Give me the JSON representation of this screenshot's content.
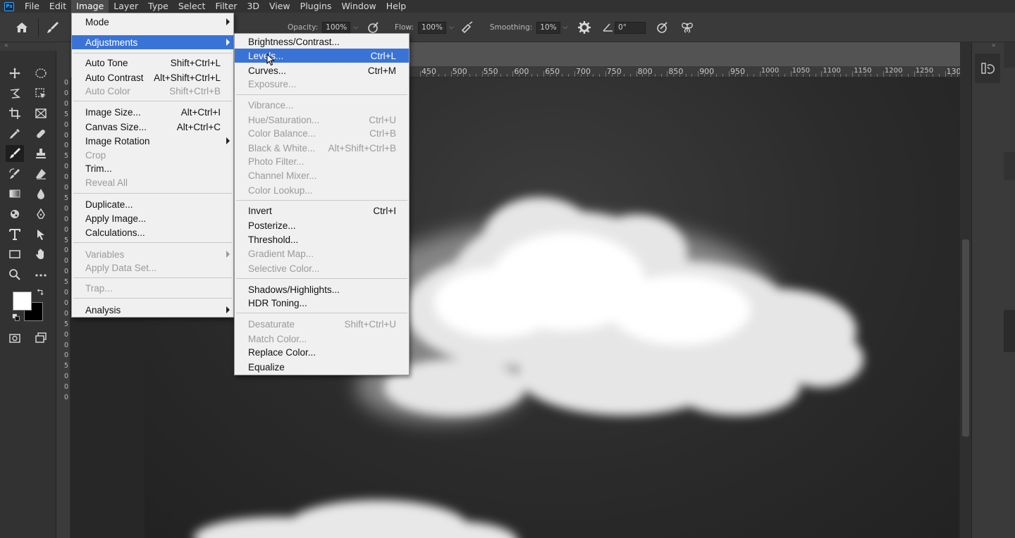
{
  "menubar": {
    "logo": "Ps",
    "items": [
      "File",
      "Edit",
      "Image",
      "Layer",
      "Type",
      "Select",
      "Filter",
      "3D",
      "View",
      "Plugins",
      "Window",
      "Help"
    ],
    "active_index": 2
  },
  "options": {
    "opacity_label": "Opacity:",
    "opacity_value": "100%",
    "flow_label": "Flow:",
    "flow_value": "100%",
    "smoothing_label": "Smoothing:",
    "smoothing_value": "10%",
    "angle_value": "0°"
  },
  "ruler": {
    "top_numbers": [
      "450",
      "500",
      "550",
      "600",
      "650",
      "700",
      "750",
      "800",
      "850",
      "900",
      "950",
      "1000",
      "1050",
      "1100",
      "1150",
      "1200",
      "1250",
      "130"
    ],
    "left_digits": [
      "0",
      "0",
      "0",
      "5",
      "0",
      "0",
      "0",
      "5",
      "0",
      "0",
      "0",
      "5",
      "0",
      "0",
      "0",
      "5",
      "0",
      "0",
      "0",
      "5",
      "0",
      "0",
      "0",
      "5",
      "0",
      "0",
      "0",
      "5",
      "0",
      "0",
      "0"
    ]
  },
  "image_menu": {
    "items": [
      {
        "label": "Mode",
        "shortcut": "",
        "submenu": true,
        "disabled": false
      },
      {
        "label": "Adjustments",
        "shortcut": "",
        "submenu": true,
        "disabled": false,
        "highlighted": true
      },
      {
        "label": "Auto Tone",
        "shortcut": "Shift+Ctrl+L",
        "disabled": false
      },
      {
        "label": "Auto Contrast",
        "shortcut": "Alt+Shift+Ctrl+L",
        "disabled": false
      },
      {
        "label": "Auto Color",
        "shortcut": "Shift+Ctrl+B",
        "disabled": true
      },
      {
        "label": "Image Size...",
        "shortcut": "Alt+Ctrl+I",
        "disabled": false
      },
      {
        "label": "Canvas Size...",
        "shortcut": "Alt+Ctrl+C",
        "disabled": false
      },
      {
        "label": "Image Rotation",
        "shortcut": "",
        "submenu": true,
        "disabled": false
      },
      {
        "label": "Crop",
        "shortcut": "",
        "disabled": true
      },
      {
        "label": "Trim...",
        "shortcut": "",
        "disabled": false
      },
      {
        "label": "Reveal All",
        "shortcut": "",
        "disabled": true
      },
      {
        "label": "Duplicate...",
        "shortcut": "",
        "disabled": false
      },
      {
        "label": "Apply Image...",
        "shortcut": "",
        "disabled": false
      },
      {
        "label": "Calculations...",
        "shortcut": "",
        "disabled": false
      },
      {
        "label": "Variables",
        "shortcut": "",
        "submenu": true,
        "disabled": true
      },
      {
        "label": "Apply Data Set...",
        "shortcut": "",
        "disabled": true
      },
      {
        "label": "Trap...",
        "shortcut": "",
        "disabled": true
      },
      {
        "label": "Analysis",
        "shortcut": "",
        "submenu": true,
        "disabled": false
      }
    ]
  },
  "adjustments_menu": {
    "items": [
      {
        "label": "Brightness/Contrast...",
        "shortcut": "",
        "disabled": false
      },
      {
        "label": "Levels...",
        "shortcut": "Ctrl+L",
        "disabled": false,
        "highlighted": true
      },
      {
        "label": "Curves...",
        "shortcut": "Ctrl+M",
        "disabled": false
      },
      {
        "label": "Exposure...",
        "shortcut": "",
        "disabled": true
      },
      {
        "label": "Vibrance...",
        "shortcut": "",
        "disabled": true
      },
      {
        "label": "Hue/Saturation...",
        "shortcut": "Ctrl+U",
        "disabled": true
      },
      {
        "label": "Color Balance...",
        "shortcut": "Ctrl+B",
        "disabled": true
      },
      {
        "label": "Black & White...",
        "shortcut": "Alt+Shift+Ctrl+B",
        "disabled": true
      },
      {
        "label": "Photo Filter...",
        "shortcut": "",
        "disabled": true
      },
      {
        "label": "Channel Mixer...",
        "shortcut": "",
        "disabled": true
      },
      {
        "label": "Color Lookup...",
        "shortcut": "",
        "disabled": true
      },
      {
        "label": "Invert",
        "shortcut": "Ctrl+I",
        "disabled": false
      },
      {
        "label": "Posterize...",
        "shortcut": "",
        "disabled": false
      },
      {
        "label": "Threshold...",
        "shortcut": "",
        "disabled": false
      },
      {
        "label": "Gradient Map...",
        "shortcut": "",
        "disabled": true
      },
      {
        "label": "Selective Color...",
        "shortcut": "",
        "disabled": true
      },
      {
        "label": "Shadows/Highlights...",
        "shortcut": "",
        "disabled": false
      },
      {
        "label": "HDR Toning...",
        "shortcut": "",
        "disabled": false
      },
      {
        "label": "Desaturate",
        "shortcut": "Shift+Ctrl+U",
        "disabled": true
      },
      {
        "label": "Match Color...",
        "shortcut": "",
        "disabled": true
      },
      {
        "label": "Replace Color...",
        "shortcut": "",
        "disabled": false
      },
      {
        "label": "Equalize",
        "shortcut": "",
        "disabled": false
      }
    ]
  },
  "colors": {
    "menu_highlight": "#3a73d6",
    "foreground_swatch": "#ffffff",
    "background_swatch": "#000000"
  }
}
